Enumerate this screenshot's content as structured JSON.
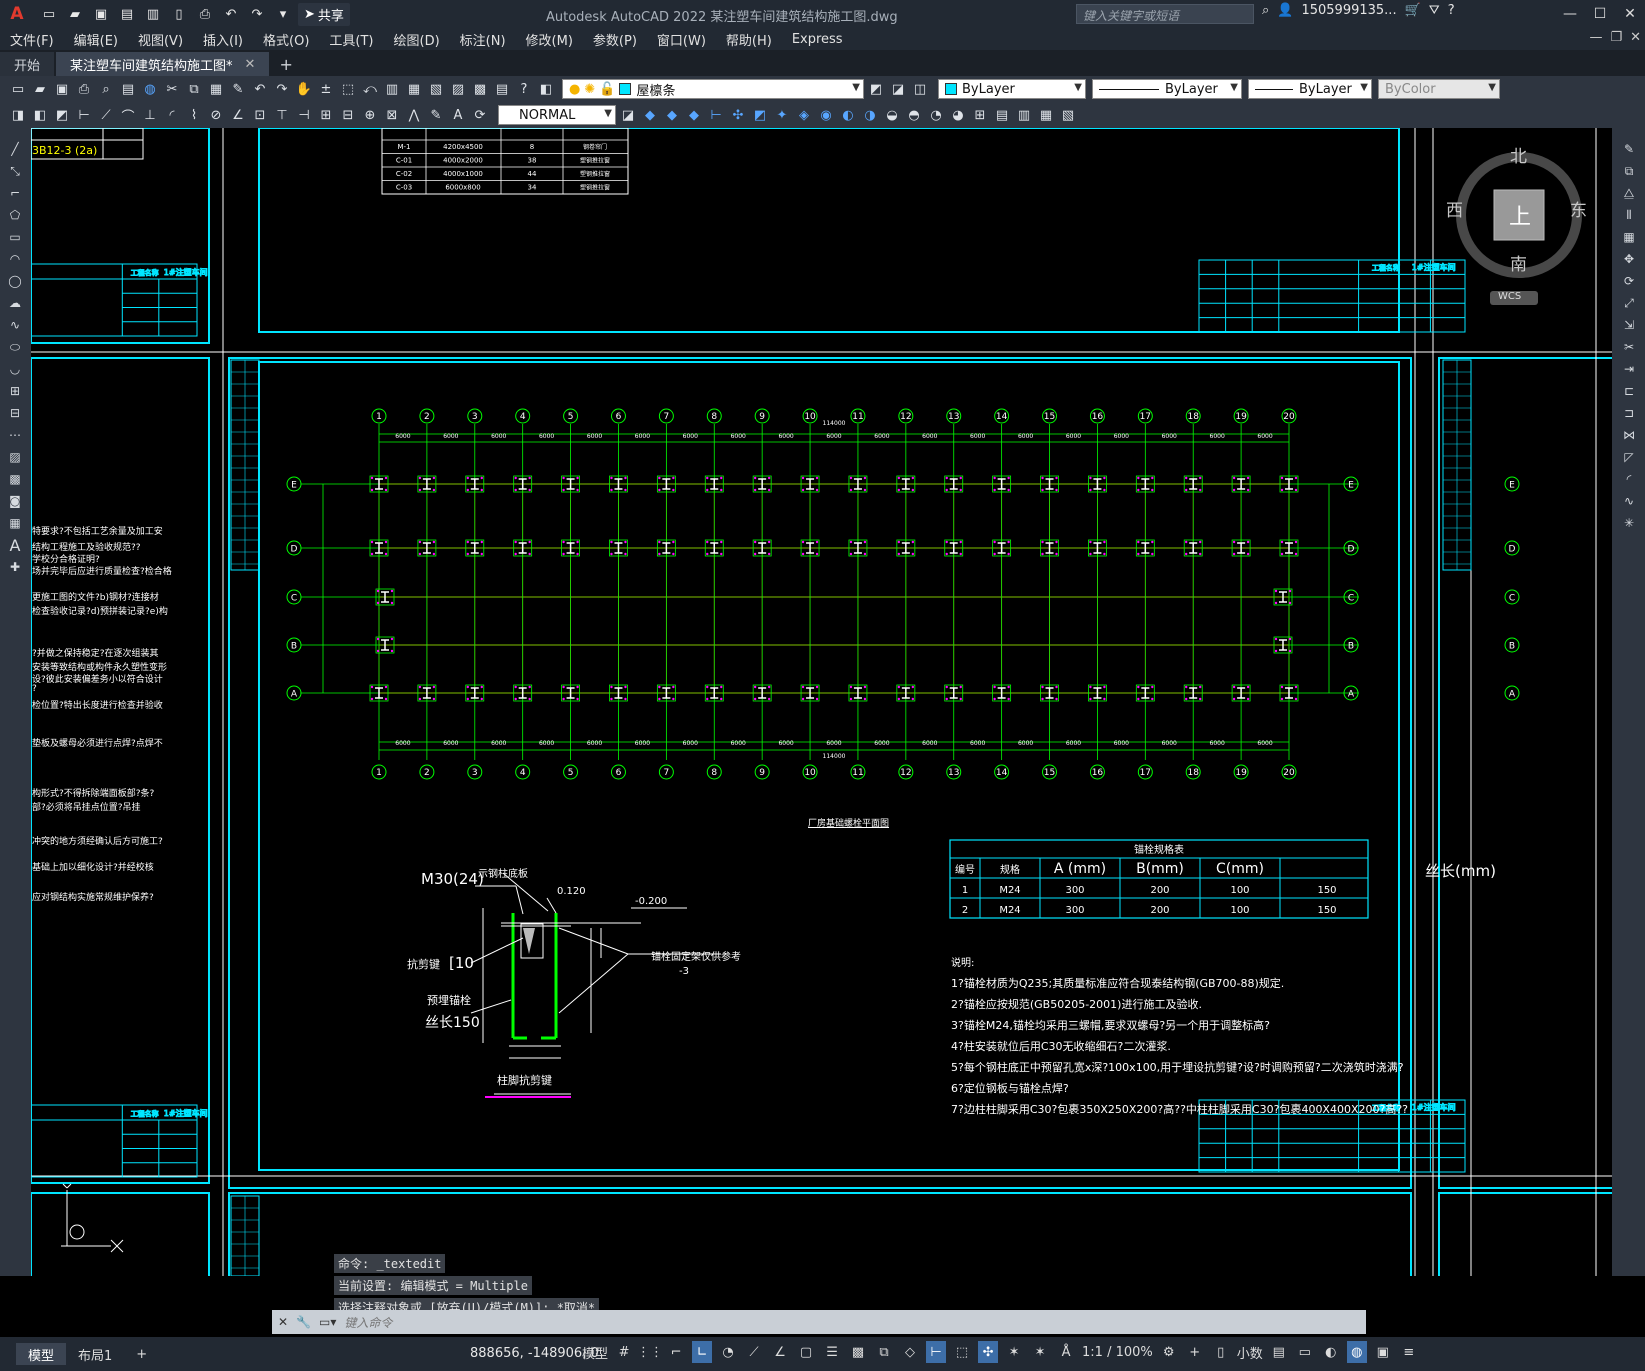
{
  "app": {
    "title": "Autodesk AutoCAD 2022    某注塑车间建筑结构施工图.dwg",
    "logo": "A",
    "share_label": "共享",
    "search_placeholder": "键入关键字或短语",
    "user": "1505999135...",
    "colors": {
      "bg": "#000000",
      "ui": "#2e3540",
      "accent_cyan": "#00e5ff",
      "green": "#00ff00",
      "red": "#ff0000"
    }
  },
  "menu": [
    "文件(F)",
    "编辑(E)",
    "视图(V)",
    "插入(I)",
    "格式(O)",
    "工具(T)",
    "绘图(D)",
    "标注(N)",
    "修改(M)",
    "参数(P)",
    "窗口(W)",
    "帮助(H)",
    "Express"
  ],
  "tabs": [
    {
      "label": "开始"
    },
    {
      "label": "某注塑车间建筑结构施工图*"
    }
  ],
  "toolbar": {
    "layer_name": "屋檩条",
    "color": "ByLayer",
    "linetype": "ByLayer",
    "lineweight": "ByLayer",
    "plotstyle": "ByColor",
    "textstyle": "NORMAL"
  },
  "viewcube": {
    "north": "北",
    "south": "南",
    "east": "东",
    "west": "西",
    "top": "上",
    "wcs": "WCS"
  },
  "drawing": {
    "door_table": [
      [
        "M-1",
        "4200x4500",
        "8",
        "钢卷帘门"
      ],
      [
        "C-01",
        "4000x2000",
        "38",
        "塑钢推拉窗"
      ],
      [
        "C-02",
        "4000x1000",
        "44",
        "塑钢推拉窗"
      ],
      [
        "C-03",
        "6000x800",
        "34",
        "塑钢推拉窗"
      ]
    ],
    "title_block_label": "工程名称",
    "project": "1#注塑车间",
    "grid_numbers": [
      "1",
      "2",
      "3",
      "4",
      "5",
      "6",
      "7",
      "8",
      "9",
      "10",
      "11",
      "12",
      "13",
      "14",
      "15",
      "16",
      "17",
      "18",
      "19",
      "20"
    ],
    "grid_letters": [
      "E",
      "D",
      "C",
      "B",
      "A"
    ],
    "spacing": "6000",
    "total": "114000",
    "plan_title": "厂房基础螺栓平面图",
    "bolt_table": {
      "title": "锚栓规格表",
      "headers": [
        "编号",
        "规格",
        "A (mm)",
        "B(mm)",
        "C(mm)"
      ],
      "rows": [
        [
          "1",
          "M24",
          "300",
          "200",
          "100",
          "150"
        ],
        [
          "2",
          "M24",
          "300",
          "200",
          "100",
          "150"
        ]
      ]
    },
    "notes_title": "说明:",
    "notes": [
      "1?锚栓材质为Q235;其质量标准应符合现泰结构钢(GB700-88)规定.",
      "2?锚栓应按规范(GB50205-2001)进行施工及验收.",
      "3?锚栓M24,锚栓均采用三螺帽,要求双螺母?另一个用于调整标高?",
      "4?柱安装就位后用C30无收缩细石?二次灌浆.",
      "5?每个钢柱底正中预留孔宽x深?100x100,用于埋设抗剪键?设?时调购预留?二次浇筑时浇满?",
      "6?定位钢板与锚栓点焊?",
      "7?边柱柱脚采用C30?包裹350X250X200?高??中柱柱脚采用C30?包裹400X400X200?高??"
    ],
    "detail": {
      "bolt": "M30(24)",
      "plate": "示钢柱底板",
      "elev1": "0.120",
      "elev2": "-0.200",
      "shear": "抗剪键",
      "shear_size": "[10",
      "embed": "预埋锚栓",
      "thread": "丝长150",
      "frame": "锚栓固定架仅供参考",
      "frame_num": "-3",
      "title": "柱脚抗剪键"
    },
    "side_fragment": "丝长(mm)",
    "left_label": "3B12-3 (2a)",
    "left_notes": [
      "特要求?不包括工艺余量及加工安",
      "结构工程施工及验收规范??",
      "学校分合格证明?",
      "场并完毕后应进行质量检查?检合格",
      "更施工图的文件?b)钢材?连接材",
      "检查验收记录?d)预拼装记录?e)构",
      "?并做之保持稳定?在逐次组装其",
      "安装等致结构或构件永久塑性变形",
      "设?彼此安装偏差务小以符合设计",
      "?",
      "检位置?特出长度进行检查并验收",
      "垫板及螺母必须进行点焊?点焊不",
      "构形式?不得拆除端面板部?条?",
      "部?必须将吊挂点位置?吊挂",
      "冲突的地方须经确认后方可施工?",
      "基础上加以细化设计?并经校核",
      "应对钢结构实施常规维护保养?"
    ]
  },
  "command": {
    "history": [
      "命令: _textedit",
      "当前设置: 编辑模式 = Multiple",
      "选择注释对象或 [放弃(U)/模式(M)]: *取消*"
    ],
    "placeholder": "键入命令"
  },
  "status": {
    "layouts": [
      "模型",
      "布局1"
    ],
    "coords": "888656, -148906, 0",
    "model": "模型",
    "scale": "1:1 / 100%",
    "units": "小数"
  }
}
